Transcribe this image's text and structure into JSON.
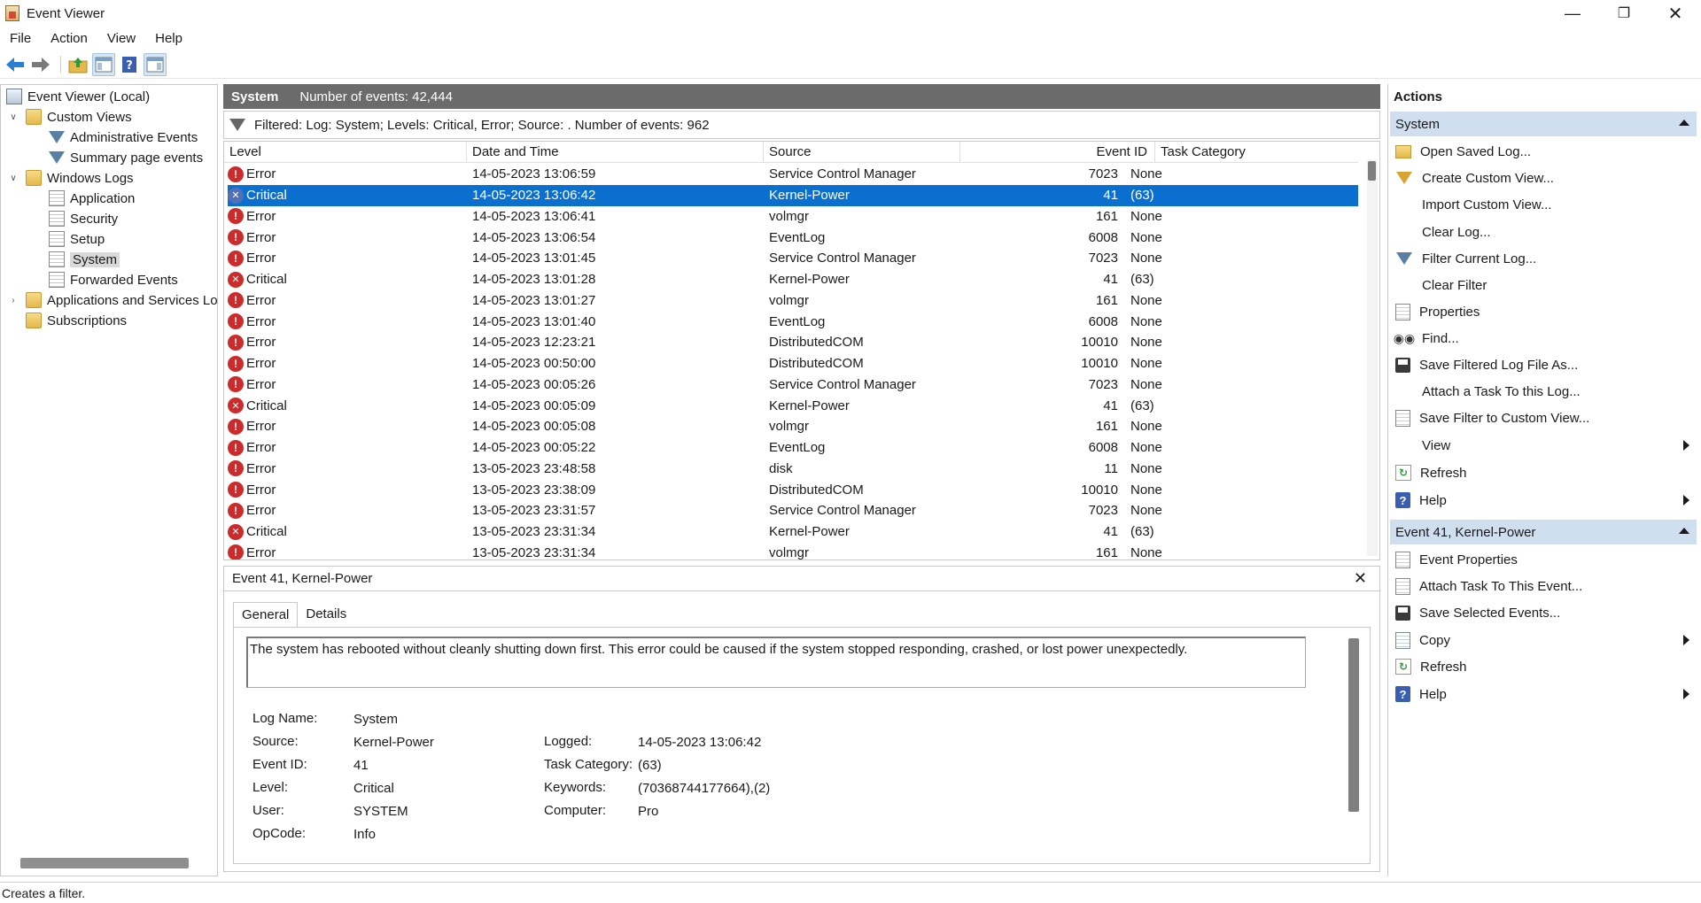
{
  "window": {
    "title": "Event Viewer"
  },
  "menu": [
    "File",
    "Action",
    "View",
    "Help"
  ],
  "tree": {
    "root": "Event Viewer (Local)",
    "custom_views": "Custom Views",
    "administrative_events": "Administrative Events",
    "summary_page_events": "Summary page events",
    "windows_logs": "Windows Logs",
    "application": "Application",
    "security": "Security",
    "setup": "Setup",
    "system": "System",
    "forwarded_events": "Forwarded Events",
    "applications_services": "Applications and Services Logs",
    "subscriptions": "Subscriptions"
  },
  "log_header": {
    "title": "System",
    "count": "Number of events: 42,444"
  },
  "filter_text": "Filtered: Log: System; Levels: Critical, Error; Source: . Number of events: 962",
  "columns": {
    "level": "Level",
    "date": "Date and Time",
    "source": "Source",
    "event_id": "Event ID",
    "task_category": "Task Category"
  },
  "events": [
    {
      "level": "Error",
      "date": "14-05-2023 13:06:59",
      "source": "Service Control Manager",
      "id": "7023",
      "category": "None"
    },
    {
      "level": "Critical",
      "date": "14-05-2023 13:06:42",
      "source": "Kernel-Power",
      "id": "41",
      "category": "(63)"
    },
    {
      "level": "Error",
      "date": "14-05-2023 13:06:41",
      "source": "volmgr",
      "id": "161",
      "category": "None"
    },
    {
      "level": "Error",
      "date": "14-05-2023 13:06:54",
      "source": "EventLog",
      "id": "6008",
      "category": "None"
    },
    {
      "level": "Error",
      "date": "14-05-2023 13:01:45",
      "source": "Service Control Manager",
      "id": "7023",
      "category": "None"
    },
    {
      "level": "Critical",
      "date": "14-05-2023 13:01:28",
      "source": "Kernel-Power",
      "id": "41",
      "category": "(63)"
    },
    {
      "level": "Error",
      "date": "14-05-2023 13:01:27",
      "source": "volmgr",
      "id": "161",
      "category": "None"
    },
    {
      "level": "Error",
      "date": "14-05-2023 13:01:40",
      "source": "EventLog",
      "id": "6008",
      "category": "None"
    },
    {
      "level": "Error",
      "date": "14-05-2023 12:23:21",
      "source": "DistributedCOM",
      "id": "10010",
      "category": "None"
    },
    {
      "level": "Error",
      "date": "14-05-2023 00:50:00",
      "source": "DistributedCOM",
      "id": "10010",
      "category": "None"
    },
    {
      "level": "Error",
      "date": "14-05-2023 00:05:26",
      "source": "Service Control Manager",
      "id": "7023",
      "category": "None"
    },
    {
      "level": "Critical",
      "date": "14-05-2023 00:05:09",
      "source": "Kernel-Power",
      "id": "41",
      "category": "(63)"
    },
    {
      "level": "Error",
      "date": "14-05-2023 00:05:08",
      "source": "volmgr",
      "id": "161",
      "category": "None"
    },
    {
      "level": "Error",
      "date": "14-05-2023 00:05:22",
      "source": "EventLog",
      "id": "6008",
      "category": "None"
    },
    {
      "level": "Error",
      "date": "13-05-2023 23:48:58",
      "source": "disk",
      "id": "11",
      "category": "None"
    },
    {
      "level": "Error",
      "date": "13-05-2023 23:38:09",
      "source": "DistributedCOM",
      "id": "10010",
      "category": "None"
    },
    {
      "level": "Error",
      "date": "13-05-2023 23:31:57",
      "source": "Service Control Manager",
      "id": "7023",
      "category": "None"
    },
    {
      "level": "Critical",
      "date": "13-05-2023 23:31:34",
      "source": "Kernel-Power",
      "id": "41",
      "category": "(63)"
    },
    {
      "level": "Error",
      "date": "13-05-2023 23:31:34",
      "source": "volmgr",
      "id": "161",
      "category": "None"
    }
  ],
  "details": {
    "title": "Event 41, Kernel-Power",
    "tab_general": "General",
    "tab_details": "Details",
    "description": "The system has rebooted without cleanly shutting down first. This error could be caused if the system stopped responding, crashed, or lost power unexpectedly.",
    "log_name_label": "Log Name:",
    "log_name": "System",
    "source_label": "Source:",
    "source": "Kernel-Power",
    "event_id_label": "Event ID:",
    "event_id": "41",
    "level_label": "Level:",
    "level": "Critical",
    "user_label": "User:",
    "user": "SYSTEM",
    "opcode_label": "OpCode:",
    "opcode": "Info",
    "logged_label": "Logged:",
    "logged": "14-05-2023 13:06:42",
    "task_category_label": "Task Category:",
    "task_category": "(63)",
    "keywords_label": "Keywords:",
    "keywords": "(70368744177664),(2)",
    "computer_label": "Computer:",
    "computer": "Pro"
  },
  "actions": {
    "title": "Actions",
    "group_system": "System",
    "open_saved_log": "Open Saved Log...",
    "create_custom_view": "Create Custom View...",
    "import_custom_view": "Import Custom View...",
    "clear_log": "Clear Log...",
    "filter_current_log": "Filter Current Log...",
    "clear_filter": "Clear Filter",
    "properties": "Properties",
    "find": "Find...",
    "save_filtered": "Save Filtered Log File As...",
    "attach_task_log": "Attach a Task To this Log...",
    "save_filter_custom": "Save Filter to Custom View...",
    "view": "View",
    "refresh": "Refresh",
    "help": "Help",
    "group_event": "Event 41, Kernel-Power",
    "event_properties": "Event Properties",
    "attach_task_event": "Attach Task To This Event...",
    "save_selected": "Save Selected Events...",
    "copy": "Copy",
    "refresh2": "Refresh",
    "help2": "Help"
  },
  "status": "Creates a filter."
}
